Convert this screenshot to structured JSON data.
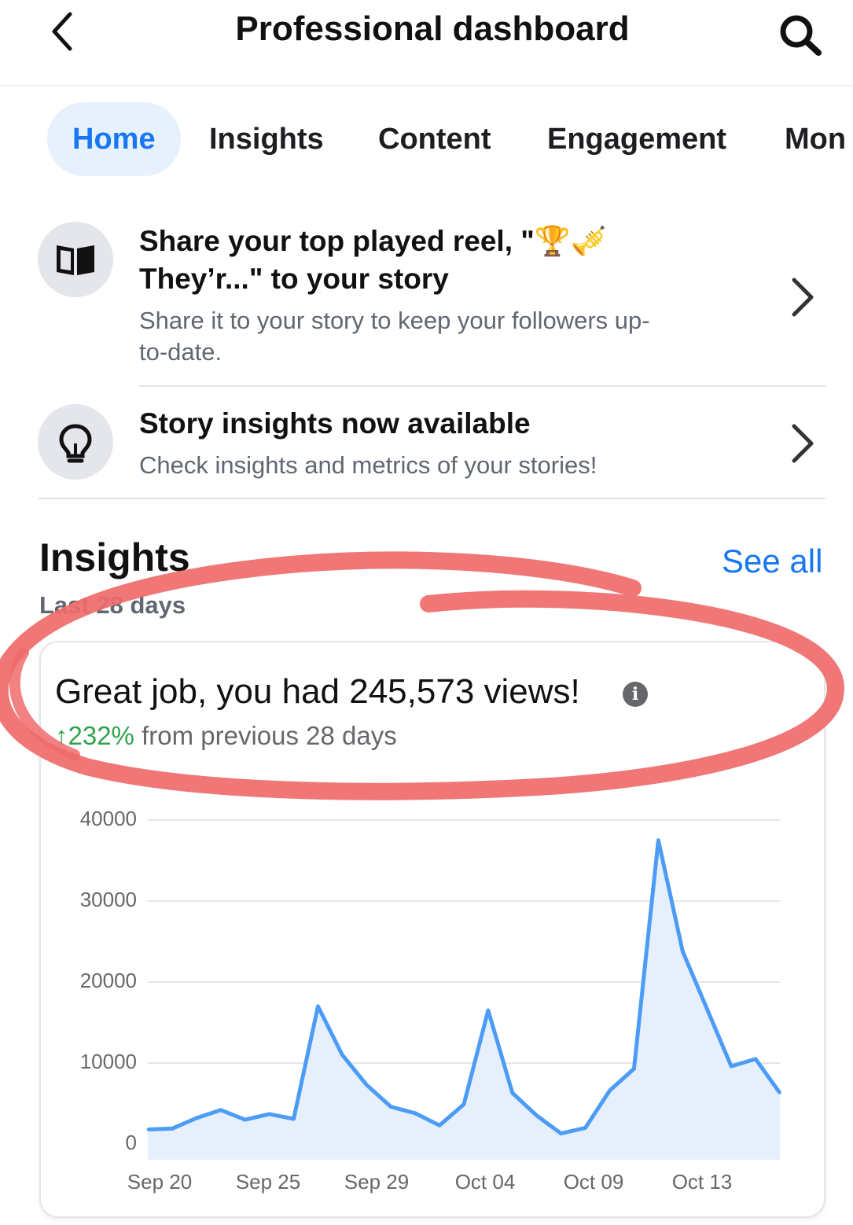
{
  "header": {
    "title": "Professional dashboard",
    "back_icon": "chevron-left-icon",
    "search_icon": "search-icon"
  },
  "tabs": [
    {
      "label": "Home",
      "active": true
    },
    {
      "label": "Insights"
    },
    {
      "label": "Content"
    },
    {
      "label": "Engagement"
    },
    {
      "label": "Mon"
    }
  ],
  "notifications": [
    {
      "icon": "book-icon",
      "title_line1": "Share your top played reel, \"🏆🎺",
      "title_line2": "They’r...\" to your story",
      "subtitle_line1": "Share it to your story to keep your followers up-",
      "subtitle_line2": "to-date."
    },
    {
      "icon": "lightbulb-icon",
      "title": "Story insights now available",
      "subtitle": "Check insights and metrics of your stories!"
    }
  ],
  "insights": {
    "title": "Insights",
    "see_all": "See all",
    "period": "Last 28 days",
    "headline": "Great job, you had 245,573 views!",
    "delta_value": "↑232%",
    "delta_text": " from previous 28 days"
  },
  "colors": {
    "accent": "#1877f2",
    "positive": "#31a24c",
    "line": "#4c9cf5",
    "fill": "#e6f0fd",
    "highlight": "#f06b6b"
  },
  "chart_data": {
    "type": "area",
    "title": "",
    "xlabel": "",
    "ylabel": "",
    "ylim": [
      0,
      40000
    ],
    "yticks": [
      0,
      10000,
      20000,
      30000,
      40000
    ],
    "x_tick_labels": [
      "Sep 20",
      "Sep 25",
      "Sep 29",
      "Oct 04",
      "Oct 09",
      "Oct 13"
    ],
    "series": [
      {
        "name": "",
        "values": [
          1800,
          1900,
          3200,
          4200,
          3000,
          3700,
          3100,
          17000,
          11000,
          7300,
          4600,
          3800,
          2300,
          4900,
          16500,
          6300,
          3500,
          1300,
          2000,
          6600,
          9300,
          37500,
          23800,
          16700,
          9600,
          10500,
          6300
        ]
      }
    ],
    "grid": true,
    "legend": "none"
  }
}
